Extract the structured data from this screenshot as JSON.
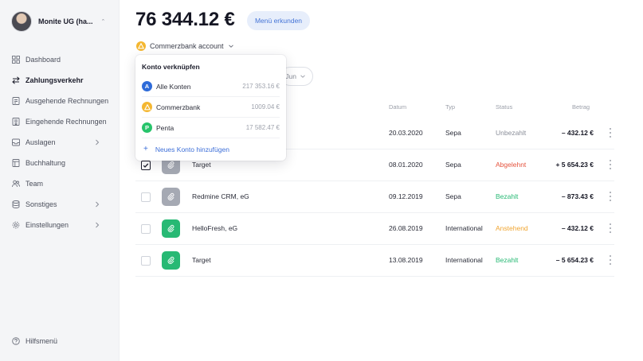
{
  "company": {
    "name": "Monite UG (ha..."
  },
  "sidebar": {
    "items": [
      {
        "label": "Dashboard",
        "icon": "grid-icon"
      },
      {
        "label": "Zahlungsverkehr",
        "icon": "transfer-icon",
        "active": true
      },
      {
        "label": "Ausgehende Rechnungen",
        "icon": "invoice-out-icon"
      },
      {
        "label": "Eingehende Rechnungen",
        "icon": "invoice-in-icon"
      },
      {
        "label": "Auslagen",
        "icon": "inbox-icon",
        "has_chevron": true
      },
      {
        "label": "Buchhaltung",
        "icon": "ledger-icon"
      },
      {
        "label": "Team",
        "icon": "team-icon"
      },
      {
        "label": "Sonstiges",
        "icon": "database-icon",
        "has_chevron": true
      },
      {
        "label": "Einstellungen",
        "icon": "gear-icon",
        "has_chevron": true
      }
    ],
    "help_label": "Hilfsmenü"
  },
  "header": {
    "balance": "76 344.12 €",
    "explore_label": "Menü erkunden",
    "account_label": "Commerzbank account",
    "period_label": "Jun"
  },
  "table": {
    "columns": {
      "date": "Datum",
      "type": "Typ",
      "status": "Status",
      "amount": "Betrag"
    },
    "rows": [
      {
        "name": "",
        "date": "20.03.2020",
        "type": "Sepa",
        "status": "Unbezahlt",
        "amount": "– 432.12 €",
        "checked": false,
        "attach": "none"
      },
      {
        "name": "Target",
        "date": "08.01.2020",
        "type": "Sepa",
        "status": "Abgelehnt",
        "amount": "+ 5 654.23 €",
        "checked": true,
        "attach": "grey"
      },
      {
        "name": "Redmine CRM, eG",
        "date": "09.12.2019",
        "type": "Sepa",
        "status": "Bezahlt",
        "amount": "– 873.43 €",
        "checked": false,
        "attach": "grey"
      },
      {
        "name": "HelloFresh, eG",
        "date": "26.08.2019",
        "type": "International",
        "status": "Anstehend",
        "amount": "– 432.12 €",
        "checked": false,
        "attach": "green"
      },
      {
        "name": "Target",
        "date": "13.08.2019",
        "type": "International",
        "status": "Bezahlt",
        "amount": "– 5 654.23 €",
        "checked": false,
        "attach": "green"
      }
    ]
  },
  "status_colors": {
    "Unbezahlt": "#8a8e99",
    "Abgelehnt": "#e5533d",
    "Bezahlt": "#27b974",
    "Anstehend": "#f0a531"
  },
  "dropdown": {
    "title": "Konto verknüpfen",
    "accounts": [
      {
        "badge": "A",
        "label": "Alle Konten",
        "amount": "217 353.16 €",
        "color": "#2e6bd9"
      },
      {
        "badge": "",
        "label": "Commerzbank",
        "amount": "1009.04 €",
        "color": "#f4b731"
      },
      {
        "badge": "P",
        "label": "Penta",
        "amount": "17 582.47 €",
        "color": "#27c46b"
      }
    ],
    "add_label": "Neues Konto hinzufügen"
  }
}
